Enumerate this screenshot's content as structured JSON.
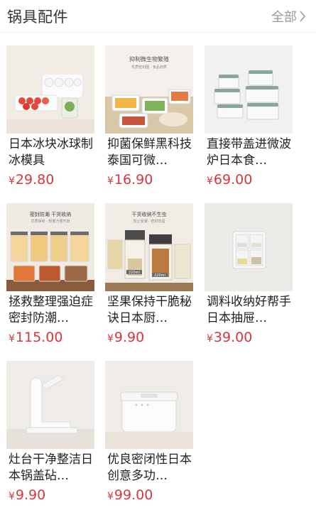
{
  "header": {
    "title": "锅具配件",
    "all_label": "全部"
  },
  "products": [
    {
      "name": "日本冰块冰球制冰模具",
      "currency": "¥",
      "price": "29.80",
      "image": "ice-tray-image"
    },
    {
      "name": "抑菌保鲜黑科技泰国可微…",
      "currency": "¥",
      "price": "16.90",
      "image": "food-container-image",
      "banner": "抑制微生物繁殖",
      "banner_sub": "优质密封圈 · 食品材质"
    },
    {
      "name": "直接带盖进微波炉日本食…",
      "currency": "¥",
      "price": "69.00",
      "image": "stacked-boxes-image"
    },
    {
      "name": "拯救整理强迫症密封防潮…",
      "currency": "¥",
      "price": "115.00",
      "image": "storage-jars-image",
      "banner": "密封防潮  干货收纳",
      "banner_sub": "优质保鲜 · 轻量方便开启"
    },
    {
      "name": "坚果保持干脆秘诀日本厨…",
      "currency": "¥",
      "price": "9.90",
      "image": "nut-jars-image",
      "banner": "干货收纳不生虫",
      "banner_sub": "防止受潮 · 密封性强",
      "labels": [
        "220ml",
        "220ml"
      ]
    },
    {
      "name": "调料收纳好帮手日本抽屉…",
      "currency": "¥",
      "price": "39.00",
      "image": "spice-box-image"
    },
    {
      "name": "灶台干净整洁日本锅盖砧…",
      "currency": "¥",
      "price": "9.90",
      "image": "lid-stand-image"
    },
    {
      "name": "优良密闭性日本创意多功…",
      "currency": "¥",
      "price": "99.00",
      "image": "rice-bin-image"
    }
  ]
}
